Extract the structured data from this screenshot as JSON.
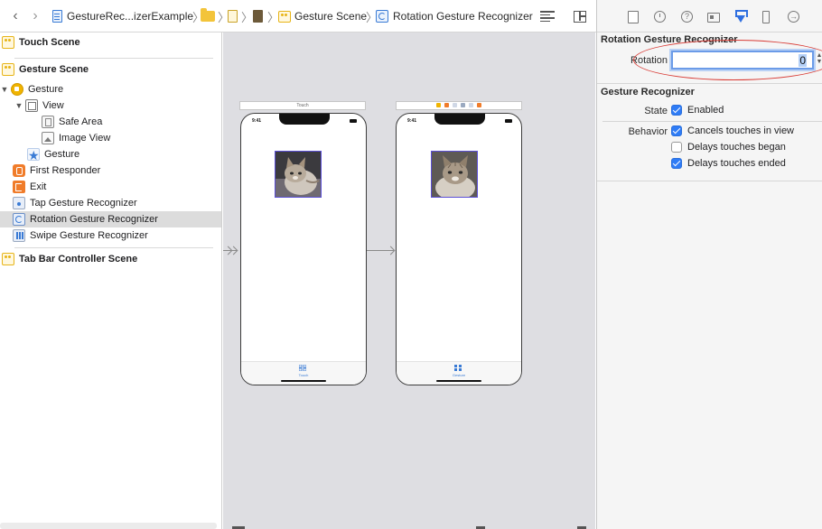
{
  "toolbar": {
    "breadcrumbs": [
      {
        "label": "GestureRec...izerExample",
        "icon": "project-file-icon"
      },
      {
        "label": "",
        "icon": "folder-icon"
      },
      {
        "label": "",
        "icon": "storyboard-file-icon"
      },
      {
        "label": "",
        "icon": "storyboard-base-icon"
      },
      {
        "label": "Gesture Scene",
        "icon": "scene-icon"
      },
      {
        "label": "Rotation Gesture Recognizer",
        "icon": "rotation-gesture-icon"
      }
    ]
  },
  "outline": {
    "items": [
      {
        "label": "Touch Scene",
        "type": "scene"
      },
      {
        "label": "Gesture Scene",
        "type": "scene"
      },
      {
        "label": "Gesture",
        "type": "view-controller"
      },
      {
        "label": "View",
        "type": "view"
      },
      {
        "label": "Safe Area",
        "type": "safe-area"
      },
      {
        "label": "Image View",
        "type": "image-view"
      },
      {
        "label": "Gesture",
        "type": "tab-bar-item"
      },
      {
        "label": "First Responder",
        "type": "first-responder"
      },
      {
        "label": "Exit",
        "type": "exit"
      },
      {
        "label": "Tap Gesture Recognizer",
        "type": "tap-gesture"
      },
      {
        "label": "Rotation Gesture Recognizer",
        "type": "rotation-gesture",
        "selected": true
      },
      {
        "label": "Swipe Gesture Recognizer",
        "type": "swipe-gesture"
      },
      {
        "label": "Tab Bar Controller Scene",
        "type": "scene"
      }
    ]
  },
  "canvas": {
    "left_scene": {
      "dock_title": "Touch",
      "time": "9:41",
      "tab_label": "Touch"
    },
    "right_scene": {
      "time": "9:41",
      "tab_label": "Gesture"
    }
  },
  "inspector": {
    "rotation_section_title": "Rotation Gesture Recognizer",
    "rotation_label": "Rotation",
    "rotation_value": "0",
    "gesture_section_title": "Gesture Recognizer",
    "state_label": "State",
    "enabled_label": "Enabled",
    "enabled_checked": true,
    "behavior_label": "Behavior",
    "behaviors": [
      {
        "label": "Cancels touches in view",
        "checked": true
      },
      {
        "label": "Delays touches began",
        "checked": false
      },
      {
        "label": "Delays touches ended",
        "checked": true
      }
    ]
  },
  "colors": {
    "accent": "#2f7cf6",
    "annotation": "#d83a34",
    "scene_icon": "#e7b417",
    "canvas_bg": "#dedee2"
  }
}
